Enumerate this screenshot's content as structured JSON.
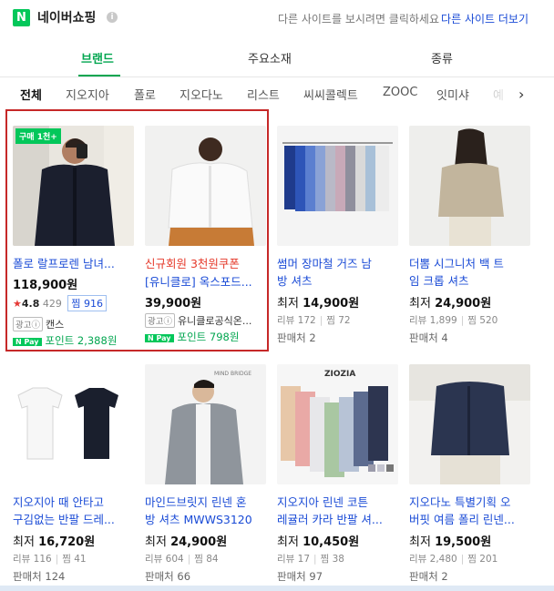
{
  "header": {
    "logo_letter": "N",
    "title": "네이버쇼핑",
    "info_icon": "i",
    "other_site_msg": "다른 사이트를 보시려면 클릭하세요",
    "other_site_link": "다른 사이트 더보기"
  },
  "category_tabs": [
    {
      "label": "브랜드",
      "active": true
    },
    {
      "label": "주요소재",
      "active": false
    },
    {
      "label": "종류",
      "active": false
    }
  ],
  "brands": [
    "전체",
    "지오지아",
    "폴로",
    "지오다노",
    "리스트",
    "씨씨콜렉트",
    "ZOOC",
    "잇미샤",
    "예"
  ],
  "next_icon": "›",
  "products": [
    {
      "badge": "구매 1천+",
      "name_line1": "폴로 랄프로렌 남녀...",
      "price": "118,900원",
      "rating": "4.8",
      "reviews": "429",
      "jjim": "찜 916",
      "ad_label": "광고ⓘ",
      "seller": "캔스",
      "npay": "N Pay",
      "point": "포인트 2,388원"
    },
    {
      "coupon": "신규회원 3천원쿠폰",
      "name_line1": "[유니클로] 옥스포드...",
      "price": "39,900원",
      "ad_label": "광고ⓘ",
      "seller": "유니클로공식온...",
      "npay": "N Pay",
      "point": "포인트 798원"
    },
    {
      "name_line1": "썸머 장마철 거즈 남",
      "name_line2": "방 셔츠",
      "price_prefix": "최저",
      "price": "14,900원",
      "review_meta": "리뷰 172",
      "jjim_meta": "찜 72",
      "sellers": "판매처 2"
    },
    {
      "name_line1": "더뽐 시그니처 백 트",
      "name_line2": "임 크롭 셔츠",
      "price_prefix": "최저",
      "price": "24,900원",
      "review_meta": "리뷰 1,899",
      "jjim_meta": "찜 520",
      "sellers": "판매처 4"
    },
    {
      "name_line1": "지오지아 때 안타고",
      "name_line2": "구김없는 반팔 드레...",
      "price_prefix": "최저",
      "price": "16,720원",
      "review_meta": "리뷰 116",
      "jjim_meta": "찜 41",
      "sellers": "판매처 124"
    },
    {
      "name_line1": "마인드브릿지 린넨 혼",
      "name_line2": "방 셔츠 MWWS3120",
      "price_prefix": "최저",
      "price": "24,900원",
      "review_meta": "리뷰 604",
      "jjim_meta": "찜 84",
      "sellers": "판매처 66"
    },
    {
      "name_line1": "지오지아 린넨 코튼",
      "name_line2": "레귤러 카라 반팔 셔...",
      "price_prefix": "최저",
      "price": "10,450원",
      "review_meta": "리뷰 17",
      "jjim_meta": "찜 38",
      "sellers": "판매처 97"
    },
    {
      "name_line1": "지오다노 특별기획 오",
      "name_line2": "버핏 여름 폴리 린넨...",
      "price_prefix": "최저",
      "price": "19,500원",
      "review_meta": "리뷰 2,480",
      "jjim_meta": "찜 201",
      "sellers": "판매처 2"
    }
  ],
  "image_text": {
    "ziozia": "ZIOZIA",
    "mindbridge": "MIND BRIDGE"
  },
  "colors": {
    "naver_green": "#03c75a",
    "link_blue": "#1a4bd6",
    "ad_highlight_red": "#c62828",
    "coupon_red": "#e5392a"
  }
}
